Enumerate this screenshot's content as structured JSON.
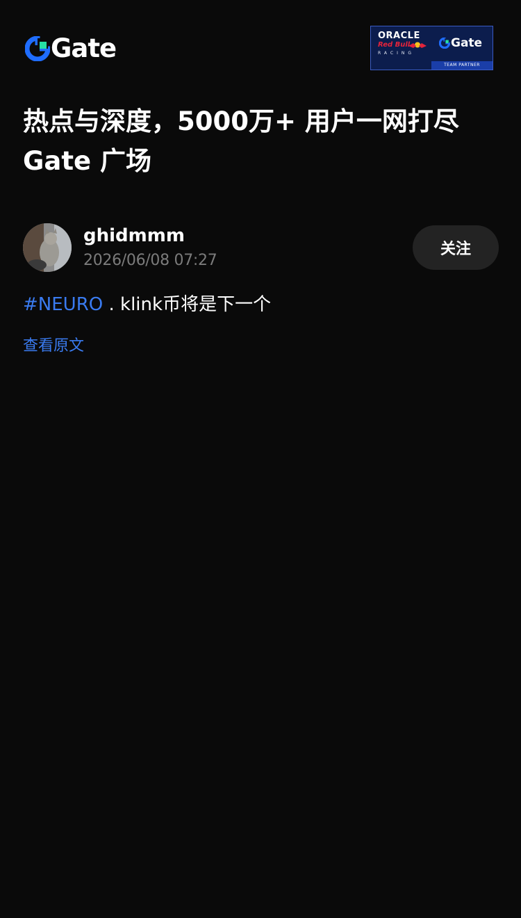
{
  "header": {
    "brand_name": "Gate",
    "partner_badge": {
      "line1": "ORACLE",
      "line2": "Red Bull",
      "line3": "RACING",
      "partner_brand": "Gate",
      "footer": "TEAM PARTNER"
    }
  },
  "headline": {
    "line1": "热点与深度，5000万+ 用户一网打尽",
    "line2": "Gate 广场"
  },
  "post": {
    "author": {
      "username": "ghidmmm",
      "timestamp": "2026/06/08 07:27",
      "avatar_icon": "cat-photo-avatar"
    },
    "follow_label": "关注",
    "hashtag": "#NEURO",
    "body_text": " . klink币将是下一个",
    "view_original_label": "查看原文"
  },
  "colors": {
    "background": "#0a0a0a",
    "accent": "#3a7bf0",
    "brand_blue": "#1f6dff",
    "brand_green": "#27e0a3",
    "muted_text": "#7b7b7b",
    "button_bg": "#232323",
    "badge_bg": "#0c1d4d"
  }
}
